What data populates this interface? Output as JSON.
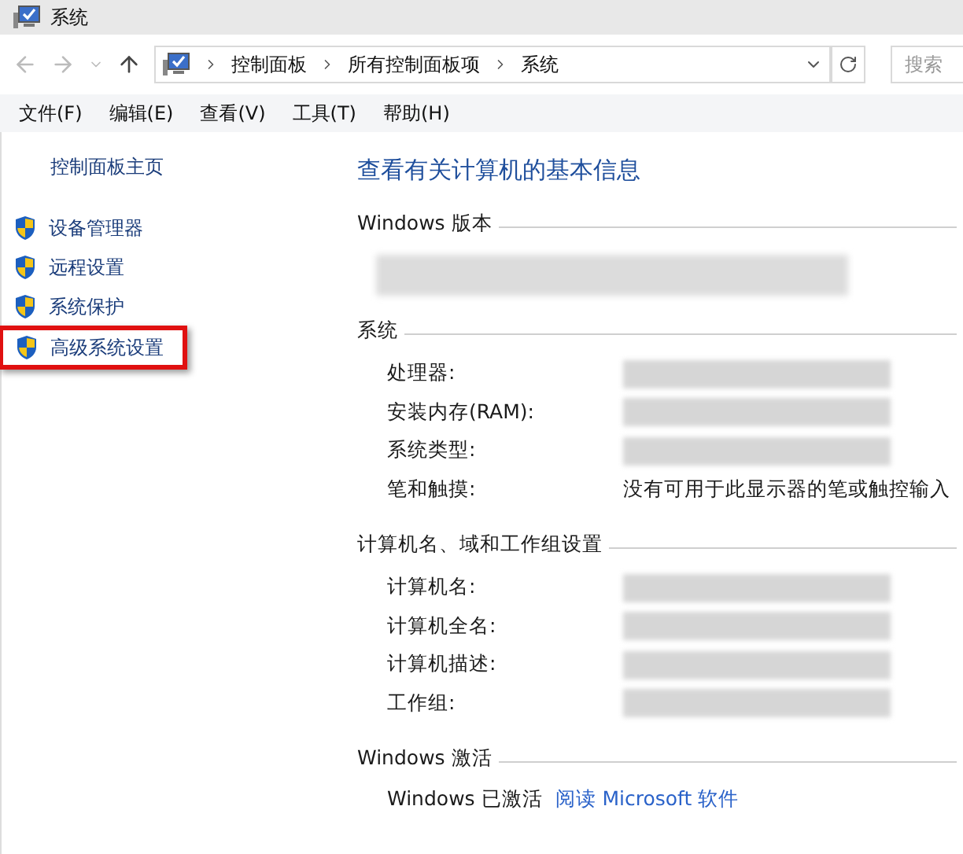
{
  "window": {
    "title": "系统"
  },
  "address_bar": {
    "crumbs": [
      "控制面板",
      "所有控制面板项",
      "系统"
    ]
  },
  "search": {
    "placeholder": "搜索"
  },
  "menu": [
    "文件(F)",
    "编辑(E)",
    "查看(V)",
    "工具(T)",
    "帮助(H)"
  ],
  "sidebar": {
    "home": "控制面板主页",
    "items": [
      {
        "label": "设备管理器",
        "highlighted": false
      },
      {
        "label": "远程设置",
        "highlighted": false
      },
      {
        "label": "系统保护",
        "highlighted": false
      },
      {
        "label": "高级系统设置",
        "highlighted": true
      }
    ]
  },
  "heading": "查看有关计算机的基本信息",
  "sections": [
    {
      "title": "Windows 版本",
      "kind": "blurred"
    },
    {
      "title": "系统",
      "kind": "rows",
      "rows": [
        {
          "label": "处理器:",
          "value": null,
          "redacted": true
        },
        {
          "label": "安装内存(RAM):",
          "value": null,
          "redacted": true
        },
        {
          "label": "系统类型:",
          "value": null,
          "redacted": true
        },
        {
          "label": "笔和触摸:",
          "value": "没有可用于此显示器的笔或触控输入",
          "redacted": false
        }
      ]
    },
    {
      "title": "计算机名、域和工作组设置",
      "kind": "rows",
      "rows": [
        {
          "label": "计算机名:",
          "value": null,
          "redacted": true
        },
        {
          "label": "计算机全名:",
          "value": null,
          "redacted": true
        },
        {
          "label": "计算机描述:",
          "value": null,
          "redacted": true
        },
        {
          "label": "工作组:",
          "value": null,
          "redacted": true
        }
      ]
    },
    {
      "title": "Windows 激活",
      "kind": "activation",
      "status": "Windows 已激活",
      "link": "阅读 Microsoft 软件"
    }
  ]
}
